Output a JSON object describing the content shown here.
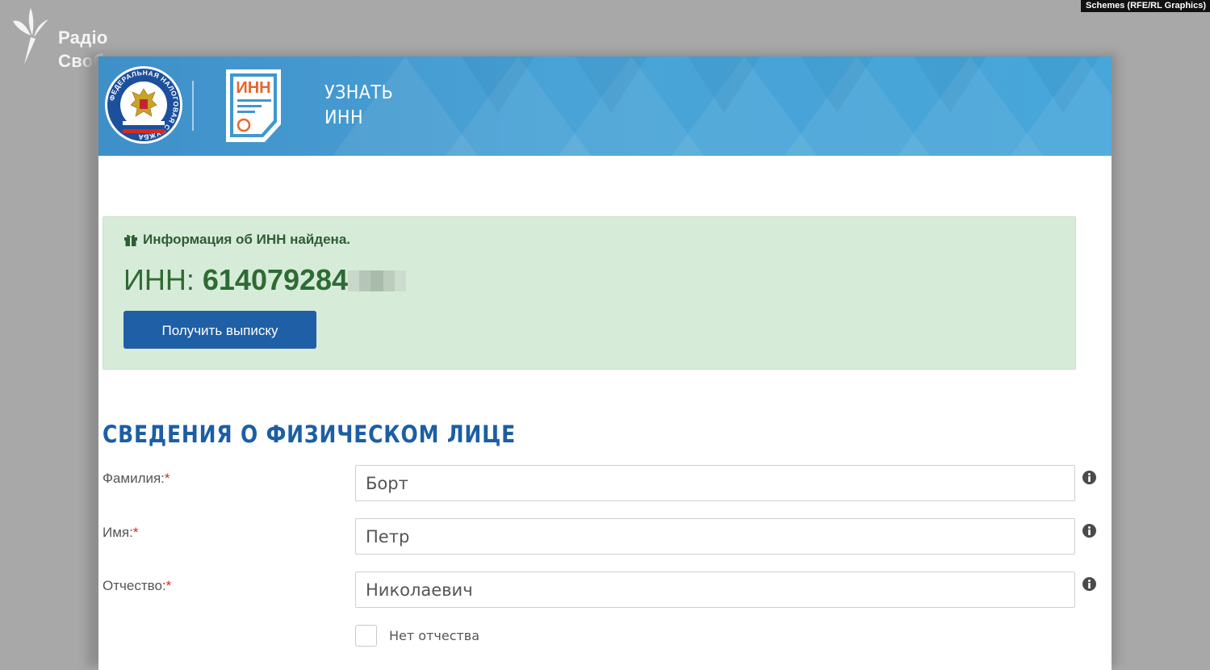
{
  "watermark": {
    "brand_line1": "Радіо",
    "brand_line2": "Свобода",
    "credit": "Schemes (RFE/RL Graphics)"
  },
  "header": {
    "emblem_ring_text": "ФЕДЕРАЛЬНАЯ НАЛОГОВАЯ СЛУЖБА",
    "doc_icon_label": "ИНН",
    "title_line1": "УЗНАТЬ",
    "title_line2": "ИНН"
  },
  "result": {
    "message": "Информация об ИНН найдена.",
    "inn_label": "ИНН:",
    "inn_value_visible": "614079284",
    "button_label": "Получить выписку"
  },
  "person": {
    "section_title": "СВЕДЕНИЯ О ФИЗИЧЕСКОМ ЛИЦЕ",
    "required_mark": "*",
    "fields": [
      {
        "label": "Фамилия:",
        "value": "Борт"
      },
      {
        "label": "Имя:",
        "value": "Петр"
      },
      {
        "label": "Отчество:",
        "value": "Николаевич"
      }
    ],
    "no_patronymic_label": "Нет отчества",
    "no_patronymic_checked": false
  },
  "colors": {
    "header_blue": "#47a6da",
    "alert_bg": "#d6ecd9",
    "alert_text": "#2e6b34",
    "button_blue": "#1f5fa5",
    "section_title": "#1c5ea4",
    "required_red": "#d9261c"
  }
}
